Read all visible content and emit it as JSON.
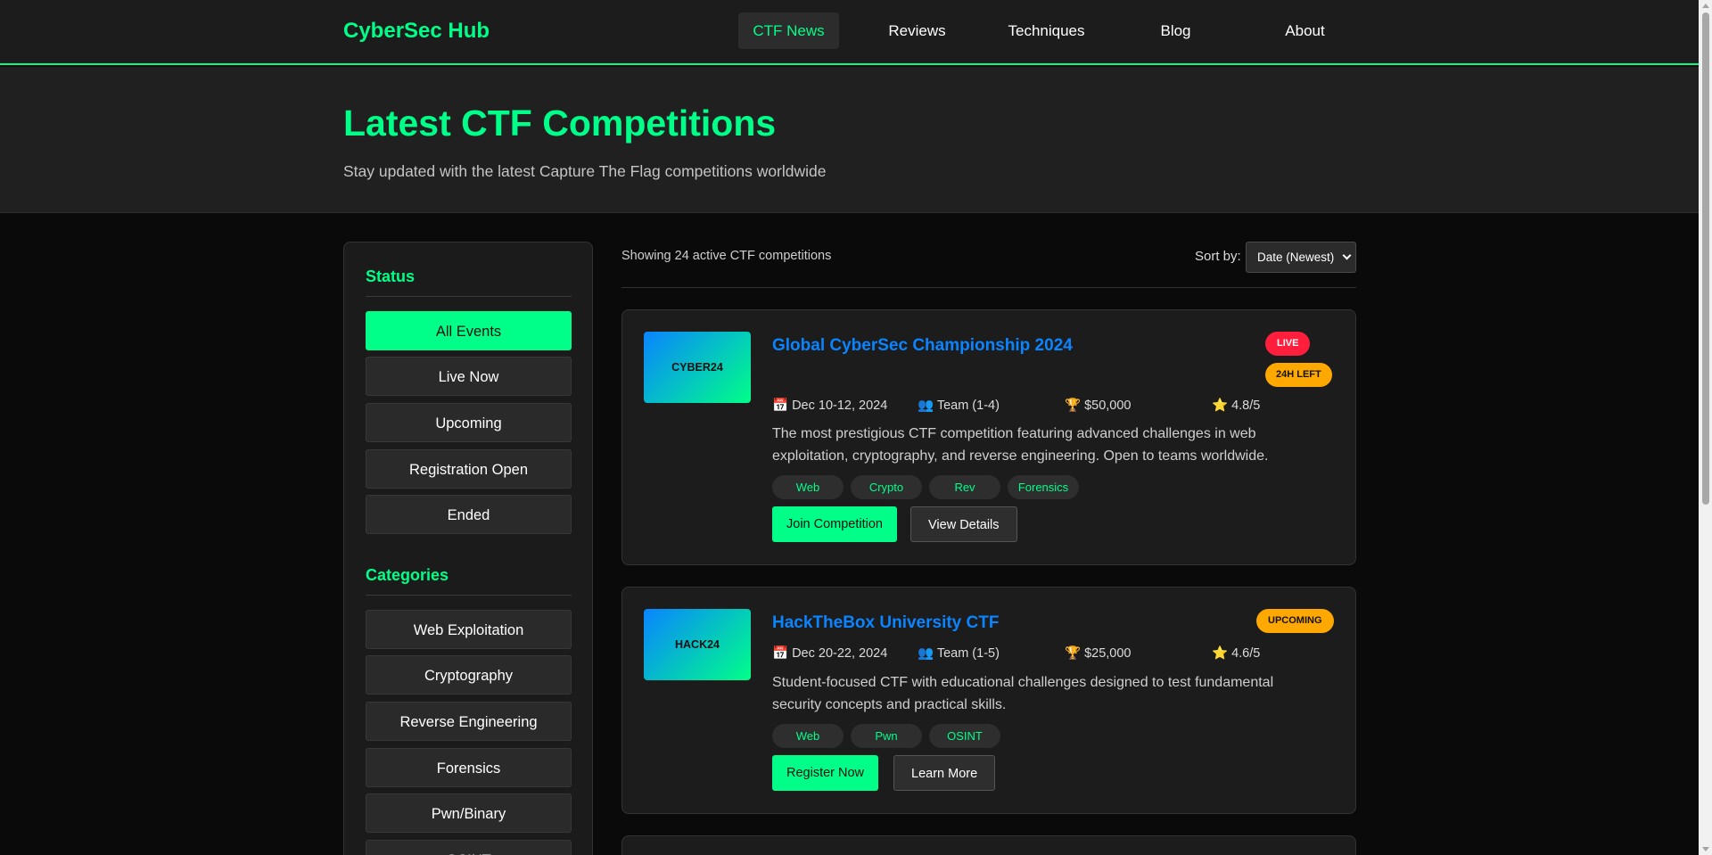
{
  "header": {
    "brand": "CyberSec Hub",
    "nav": [
      {
        "label": "CTF News",
        "active": true
      },
      {
        "label": "Reviews"
      },
      {
        "label": "Techniques"
      },
      {
        "label": "Blog"
      },
      {
        "label": "About"
      }
    ]
  },
  "hero": {
    "title": "Latest CTF Competitions",
    "subtitle": "Stay updated with the latest Capture The Flag competitions worldwide"
  },
  "sidebar": {
    "status_title": "Status",
    "status_filters": [
      "All Events",
      "Live Now",
      "Upcoming",
      "Registration Open",
      "Ended"
    ],
    "active_status": "All Events",
    "categories_title": "Categories",
    "category_filters": [
      "Web Exploitation",
      "Cryptography",
      "Reverse Engineering",
      "Forensics",
      "Pwn/Binary",
      "OSINT"
    ]
  },
  "toolbar": {
    "results_text": "Showing 24 active CTF competitions",
    "sort_label": "Sort by:",
    "sort_value": "Date (Newest)"
  },
  "competitions": [
    {
      "thumb": "CYBER24",
      "title": "Global CyberSec Championship 2024",
      "badges": [
        "LIVE",
        "24H LEFT"
      ],
      "date": "📅 Dec 10-12, 2024",
      "team": "👥 Team (1-4)",
      "prize": "🏆 $50,000",
      "rating": "⭐ 4.8/5",
      "description": "The most prestigious CTF competition featuring advanced challenges in web exploitation, cryptography, and reverse engineering. Open to teams worldwide.",
      "tags": [
        "Web",
        "Crypto",
        "Rev",
        "Forensics"
      ],
      "primary_action": "Join Competition",
      "secondary_action": "View Details"
    },
    {
      "thumb": "HACK24",
      "title": "HackTheBox University CTF",
      "badges": [
        "UPCOMING"
      ],
      "date": "📅 Dec 20-22, 2024",
      "team": "👥 Team (1-5)",
      "prize": "🏆 $25,000",
      "rating": "⭐ 4.6/5",
      "description": "Student-focused CTF with educational challenges designed to test fundamental security concepts and practical skills.",
      "tags": [
        "Web",
        "Pwn",
        "OSINT"
      ],
      "primary_action": "Register Now",
      "secondary_action": "Learn More"
    }
  ],
  "colors": {
    "accent": "#00ff88",
    "link": "#0a84ff",
    "live": "#ff1f3d",
    "warning": "#ffa800",
    "background": "#0a0a0a"
  }
}
